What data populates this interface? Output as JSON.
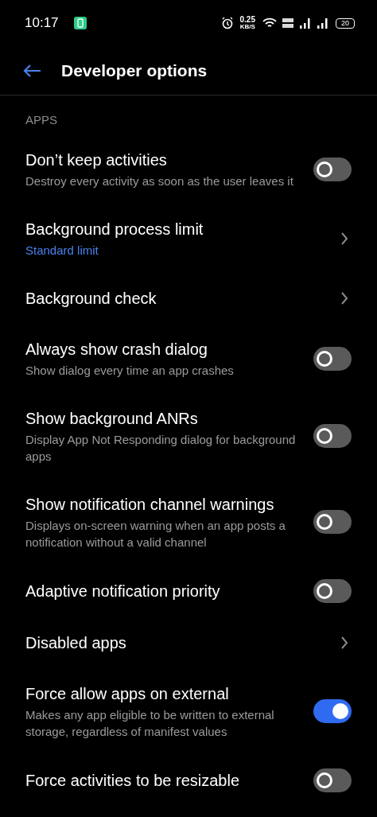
{
  "status_bar": {
    "time": "10:17",
    "speed_value": "0.25",
    "speed_unit": "KB/S",
    "battery": "20"
  },
  "header": {
    "title": "Developer options"
  },
  "section": {
    "title": "APPS"
  },
  "items": [
    {
      "kind": "toggle",
      "title": "Don’t keep activities",
      "subtitle": "Destroy every activity as soon as the user leaves it",
      "on": false
    },
    {
      "kind": "link",
      "title": "Background process limit",
      "value": "Standard limit"
    },
    {
      "kind": "link",
      "title": "Background check"
    },
    {
      "kind": "toggle",
      "title": "Always show crash dialog",
      "subtitle": "Show dialog every time an app crashes",
      "on": false
    },
    {
      "kind": "toggle",
      "title": "Show background ANRs",
      "subtitle": "Display App Not Responding dialog for background apps",
      "on": false
    },
    {
      "kind": "toggle",
      "title": "Show notification channel warnings",
      "subtitle": "Displays on-screen warning when an app posts a notification without a valid channel",
      "on": false
    },
    {
      "kind": "toggle",
      "title": "Adaptive notification priority",
      "on": false
    },
    {
      "kind": "link",
      "title": "Disabled apps"
    },
    {
      "kind": "toggle",
      "title": "Force allow apps on external",
      "subtitle": "Makes any app eligible to be written to external storage, regardless of manifest values",
      "on": true
    },
    {
      "kind": "toggle",
      "title": "Force activities to be resizable",
      "on": false
    }
  ]
}
